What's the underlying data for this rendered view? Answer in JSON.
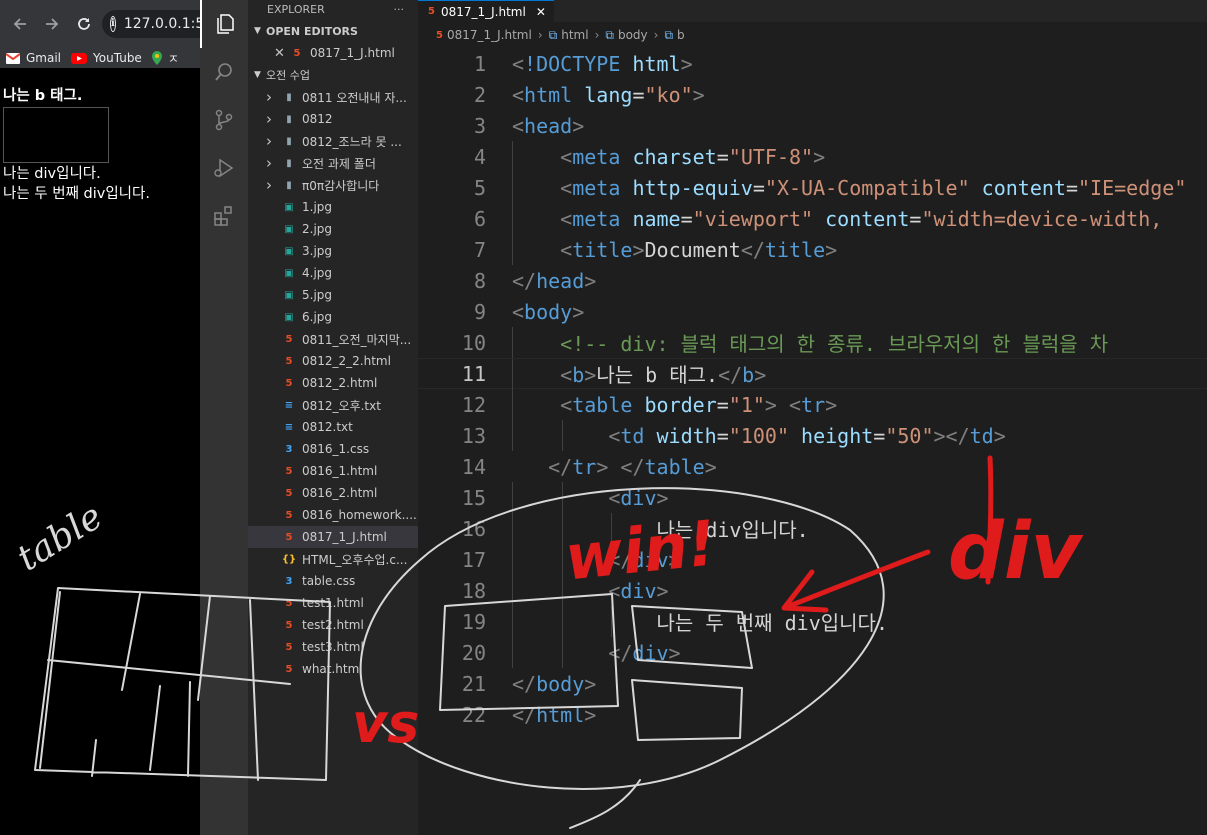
{
  "browser": {
    "url": "127.0.0.1:5",
    "bookmarks": [
      {
        "label": "Gmail",
        "icon": "gmail-icon"
      },
      {
        "label": "YouTube",
        "icon": "youtube-icon"
      },
      {
        "label": "ㅈ",
        "icon": "maps-icon"
      }
    ],
    "content": {
      "bold_text": "나는 b 태그.",
      "div1": "나는 div입니다.",
      "div2": "나는 두 번째 div입니다."
    }
  },
  "sidebar": {
    "title": "EXPLORER",
    "more": "···",
    "open_editors_label": "OPEN EDITORS",
    "open_editor_file": "0817_1_J.html",
    "folder_label": "오전 수업",
    "folders": [
      "0811 오전내내 자...",
      "0812",
      "0812_조느라 못 ...",
      "오전 과제 폴더",
      "π0π감사합니다"
    ],
    "files": [
      {
        "name": "1.jpg",
        "type": "img"
      },
      {
        "name": "2.jpg",
        "type": "img"
      },
      {
        "name": "3.jpg",
        "type": "img"
      },
      {
        "name": "4.jpg",
        "type": "img"
      },
      {
        "name": "5.jpg",
        "type": "img"
      },
      {
        "name": "6.jpg",
        "type": "img"
      },
      {
        "name": "0811_오전_마지막...",
        "type": "html"
      },
      {
        "name": "0812_2_2.html",
        "type": "html"
      },
      {
        "name": "0812_2.html",
        "type": "html"
      },
      {
        "name": "0812_오후.txt",
        "type": "txt"
      },
      {
        "name": "0812.txt",
        "type": "txt"
      },
      {
        "name": "0816_1.css",
        "type": "css"
      },
      {
        "name": "0816_1.html",
        "type": "html"
      },
      {
        "name": "0816_2.html",
        "type": "html"
      },
      {
        "name": "0816_homework....",
        "type": "html"
      },
      {
        "name": "0817_1_J.html",
        "type": "html",
        "selected": true
      },
      {
        "name": "HTML_오후수업.c...",
        "type": "json"
      },
      {
        "name": "table.css",
        "type": "css"
      },
      {
        "name": "test1.html",
        "type": "html"
      },
      {
        "name": "test2.html",
        "type": "html"
      },
      {
        "name": "test3.html",
        "type": "html"
      },
      {
        "name": "what.html",
        "type": "html"
      }
    ]
  },
  "editor": {
    "tab_label": "0817_1_J.html",
    "breadcrumb": [
      "0817_1_J.html",
      "html",
      "body",
      "b"
    ],
    "current_line": 11,
    "lines": [
      {
        "n": "1",
        "indent": 0,
        "tokens": [
          [
            "p",
            "<"
          ],
          [
            "t",
            "!DOCTYPE"
          ],
          [
            "x",
            " "
          ],
          [
            "a",
            "html"
          ],
          [
            "p",
            ">"
          ]
        ]
      },
      {
        "n": "2",
        "indent": 0,
        "tokens": [
          [
            "p",
            "<"
          ],
          [
            "t",
            "html"
          ],
          [
            "x",
            " "
          ],
          [
            "a",
            "lang"
          ],
          [
            "x",
            "="
          ],
          [
            "s",
            "\"ko\""
          ],
          [
            "p",
            ">"
          ]
        ]
      },
      {
        "n": "3",
        "indent": 0,
        "tokens": [
          [
            "p",
            "<"
          ],
          [
            "t",
            "head"
          ],
          [
            "p",
            ">"
          ]
        ]
      },
      {
        "n": "4",
        "indent": 1,
        "tokens": [
          [
            "p",
            "<"
          ],
          [
            "t",
            "meta"
          ],
          [
            "x",
            " "
          ],
          [
            "a",
            "charset"
          ],
          [
            "x",
            "="
          ],
          [
            "s",
            "\"UTF-8\""
          ],
          [
            "p",
            ">"
          ]
        ]
      },
      {
        "n": "5",
        "indent": 1,
        "tokens": [
          [
            "p",
            "<"
          ],
          [
            "t",
            "meta"
          ],
          [
            "x",
            " "
          ],
          [
            "a",
            "http-equiv"
          ],
          [
            "x",
            "="
          ],
          [
            "s",
            "\"X-UA-Compatible\""
          ],
          [
            "x",
            " "
          ],
          [
            "a",
            "content"
          ],
          [
            "x",
            "="
          ],
          [
            "s",
            "\"IE=edge\""
          ]
        ]
      },
      {
        "n": "6",
        "indent": 1,
        "tokens": [
          [
            "p",
            "<"
          ],
          [
            "t",
            "meta"
          ],
          [
            "x",
            " "
          ],
          [
            "a",
            "name"
          ],
          [
            "x",
            "="
          ],
          [
            "s",
            "\"viewport\""
          ],
          [
            "x",
            " "
          ],
          [
            "a",
            "content"
          ],
          [
            "x",
            "="
          ],
          [
            "s",
            "\"width=device-width,"
          ]
        ]
      },
      {
        "n": "7",
        "indent": 1,
        "tokens": [
          [
            "p",
            "<"
          ],
          [
            "t",
            "title"
          ],
          [
            "p",
            ">"
          ],
          [
            "x",
            "Document"
          ],
          [
            "p",
            "</"
          ],
          [
            "t",
            "title"
          ],
          [
            "p",
            ">"
          ]
        ]
      },
      {
        "n": "8",
        "indent": 0,
        "tokens": [
          [
            "p",
            "</"
          ],
          [
            "t",
            "head"
          ],
          [
            "p",
            ">"
          ]
        ]
      },
      {
        "n": "9",
        "indent": 0,
        "tokens": [
          [
            "p",
            "<"
          ],
          [
            "t",
            "body"
          ],
          [
            "p",
            ">"
          ]
        ]
      },
      {
        "n": "10",
        "indent": 1,
        "tokens": [
          [
            "c",
            "<!-- div: 블럭 태그의 한 종류. 브라우저의 한 블럭을 차"
          ]
        ]
      },
      {
        "n": "11",
        "indent": 1,
        "tokens": [
          [
            "p",
            "<"
          ],
          [
            "t",
            "b"
          ],
          [
            "p",
            ">"
          ],
          [
            "x",
            "나는 b 태그."
          ],
          [
            "p",
            "</"
          ],
          [
            "t",
            "b"
          ],
          [
            "p",
            ">"
          ]
        ]
      },
      {
        "n": "12",
        "indent": 1,
        "tokens": [
          [
            "p",
            "<"
          ],
          [
            "t",
            "table"
          ],
          [
            "x",
            " "
          ],
          [
            "a",
            "border"
          ],
          [
            "x",
            "="
          ],
          [
            "s",
            "\"1\""
          ],
          [
            "p",
            ">"
          ],
          [
            "x",
            " "
          ],
          [
            "p",
            "<"
          ],
          [
            "t",
            "tr"
          ],
          [
            "p",
            ">"
          ]
        ]
      },
      {
        "n": "13",
        "indent": 2,
        "tokens": [
          [
            "p",
            "<"
          ],
          [
            "t",
            "td"
          ],
          [
            "x",
            " "
          ],
          [
            "a",
            "width"
          ],
          [
            "x",
            "="
          ],
          [
            "s",
            "\"100\""
          ],
          [
            "x",
            " "
          ],
          [
            "a",
            "height"
          ],
          [
            "x",
            "="
          ],
          [
            "s",
            "\"50\""
          ],
          [
            "p",
            "></"
          ],
          [
            "t",
            "td"
          ],
          [
            "p",
            ">"
          ]
        ]
      },
      {
        "n": "14",
        "indent": 0,
        "pre": "   ",
        "tokens": [
          [
            "p",
            "</"
          ],
          [
            "t",
            "tr"
          ],
          [
            "p",
            ">"
          ],
          [
            "x",
            " "
          ],
          [
            "p",
            "</"
          ],
          [
            "t",
            "table"
          ],
          [
            "p",
            ">"
          ]
        ]
      },
      {
        "n": "15",
        "indent": 2,
        "tokens": [
          [
            "p",
            "<"
          ],
          [
            "t",
            "div"
          ],
          [
            "p",
            ">"
          ]
        ]
      },
      {
        "n": "16",
        "indent": 3,
        "tokens": [
          [
            "x",
            "나는 div입니다."
          ]
        ]
      },
      {
        "n": "17",
        "indent": 2,
        "tokens": [
          [
            "p",
            "</"
          ],
          [
            "t",
            "div"
          ],
          [
            "p",
            ">"
          ]
        ]
      },
      {
        "n": "18",
        "indent": 2,
        "tokens": [
          [
            "p",
            "<"
          ],
          [
            "t",
            "div"
          ],
          [
            "p",
            ">"
          ]
        ]
      },
      {
        "n": "19",
        "indent": 3,
        "tokens": [
          [
            "x",
            "나는 두 번째 div입니다."
          ]
        ]
      },
      {
        "n": "20",
        "indent": 2,
        "tokens": [
          [
            "p",
            "</"
          ],
          [
            "t",
            "div"
          ],
          [
            "p",
            ">"
          ]
        ]
      },
      {
        "n": "21",
        "indent": 0,
        "tokens": [
          [
            "p",
            "</"
          ],
          [
            "t",
            "body"
          ],
          [
            "p",
            ">"
          ]
        ]
      },
      {
        "n": "22",
        "indent": 0,
        "tokens": [
          [
            "p",
            "</"
          ],
          [
            "t",
            "html"
          ],
          [
            "p",
            ">"
          ]
        ]
      }
    ]
  },
  "annotations": {
    "table_note": "table",
    "vs": "vs",
    "win": "win!",
    "div": "div",
    "colors": {
      "red": "#e01b1b",
      "white": "#d8d8d8"
    }
  }
}
